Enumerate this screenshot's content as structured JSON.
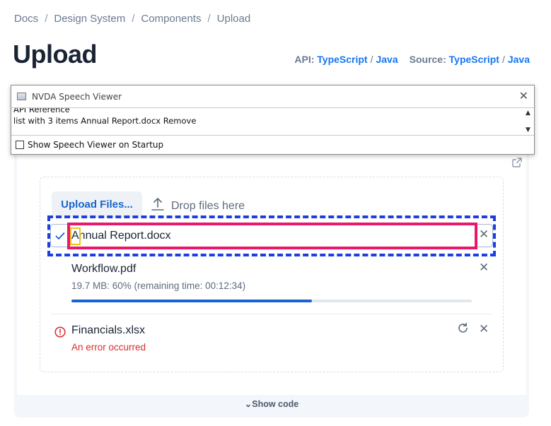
{
  "breadcrumb": [
    "Docs",
    "Design System",
    "Components",
    "Upload"
  ],
  "page_title": "Upload",
  "api_links": {
    "api_label": "API:",
    "api_ts": "TypeScript",
    "api_java": "Java",
    "source_label": "Source:",
    "source_ts": "TypeScript",
    "source_java": "Java",
    "separator": "/"
  },
  "nvda": {
    "title": "NVDA Speech Viewer",
    "line1": "API Reference",
    "line2": "list  with 3 items  Annual Report.docx  Remove",
    "startup_checkbox_label": "Show Speech Viewer on Startup",
    "startup_checked": false
  },
  "upload": {
    "button_label": "Upload Files...",
    "drop_label": "Drop files here",
    "files": [
      {
        "name": "Annual Report.docx",
        "state": "complete"
      },
      {
        "name": "Workflow.pdf",
        "state": "uploading",
        "status": "19.7 MB: 60% (remaining time: 00:12:34)",
        "progress": 0.6
      },
      {
        "name": "Financials.xlsx",
        "state": "error",
        "status": "An error occurred"
      }
    ]
  },
  "show_code_label": "Show code",
  "colors": {
    "accent": "#1764cf",
    "error": "#d92c2c",
    "focus_dashed": "#1d3fe0",
    "highlight": "#e8196c",
    "caret_highlight": "#f0c419"
  }
}
